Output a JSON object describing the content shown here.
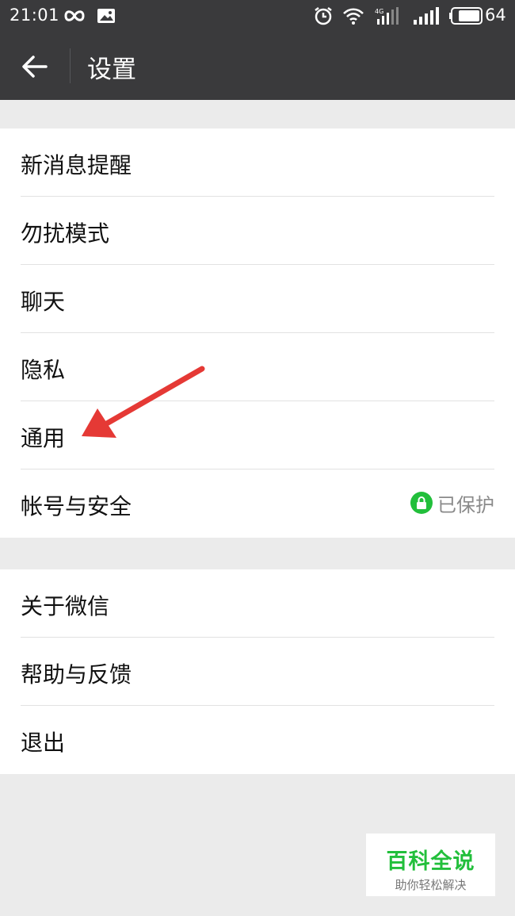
{
  "status_bar": {
    "time": "21:01",
    "battery": "64"
  },
  "header": {
    "title": "设置"
  },
  "group1": [
    {
      "label": "新消息提醒"
    },
    {
      "label": "勿扰模式"
    },
    {
      "label": "聊天"
    },
    {
      "label": "隐私"
    },
    {
      "label": "通用"
    },
    {
      "label": "帐号与安全",
      "status": "已保护"
    }
  ],
  "group2": [
    {
      "label": "关于微信"
    },
    {
      "label": "帮助与反馈"
    },
    {
      "label": "退出"
    }
  ],
  "watermark": {
    "title": "百科全说",
    "subtitle": "助你轻松解决"
  },
  "colors": {
    "bar": "#3a3a3c",
    "accent_green": "#22bf3b",
    "arrow": "#e53935"
  }
}
